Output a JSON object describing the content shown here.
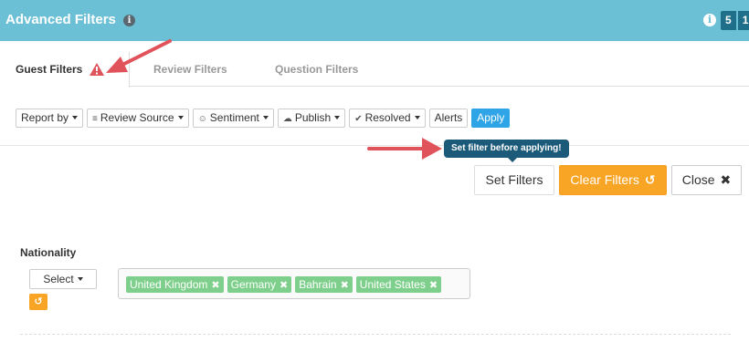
{
  "header": {
    "title": "Advanced Filters",
    "info_icon": "i",
    "badges": [
      "5",
      "1"
    ]
  },
  "tabs": [
    {
      "label": "Guest Filters",
      "active": true,
      "warning": true
    },
    {
      "label": "Review Filters",
      "active": false
    },
    {
      "label": "Question Filters",
      "active": false
    }
  ],
  "toolbar": {
    "report_by": "Report by",
    "review_source": "Review Source",
    "sentiment": "Sentiment",
    "publish": "Publish",
    "resolved": "Resolved",
    "alerts": "Alerts",
    "apply": "Apply"
  },
  "tooltip": "Set filter before applying!",
  "actions": {
    "set_filters": "Set Filters",
    "clear_filters": "Clear Filters",
    "close": "Close"
  },
  "nationality": {
    "label": "Nationality",
    "select_label": "Select",
    "tags": [
      "United Kingdom",
      "Germany",
      "Bahrain",
      "United States"
    ]
  },
  "colors": {
    "header_bg": "#6cc0d6",
    "apply": "#2fa4e7",
    "clear": "#f8a424",
    "tag": "#7dcf8b",
    "tooltip": "#1b5a79",
    "annotation_arrow": "#e0535a"
  }
}
